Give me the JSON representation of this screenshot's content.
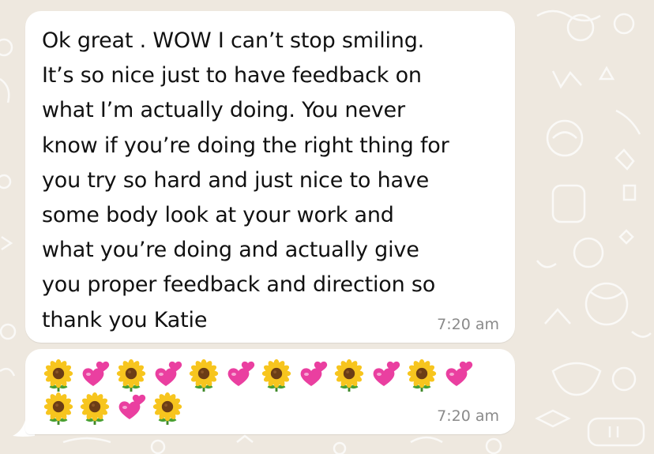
{
  "chat": {
    "messages": [
      {
        "text": "Ok great . WOW I can’t stop smiling.\nIt’s so nice just to have feedback on\nwhat I’m actually doing. You never\nknow if you’re doing the right thing for\nyou try so hard and just nice to have\nsome body look at your work and\nwhat you’re doing and actually give\nyou proper feedback and direction so\nthank you Katie",
        "time": "7:20 am"
      },
      {
        "emoji_rows": [
          [
            "sunflower",
            "growing-heart",
            "sunflower",
            "growing-heart",
            "sunflower",
            "growing-heart",
            "sunflower",
            "growing-heart",
            "sunflower",
            "growing-heart",
            "sunflower",
            "growing-heart"
          ],
          [
            "sunflower",
            "sunflower",
            "growing-heart",
            "sunflower"
          ]
        ],
        "time": "7:20 am"
      }
    ]
  },
  "colors": {
    "bubble": "#ffffff",
    "wallpaper": "#eee8df",
    "text": "#111111",
    "timestamp": "#8a8a8a",
    "sunflower_petal": "#f7c51e",
    "sunflower_center": "#6b3d16",
    "heart": "#ea3fa0"
  }
}
